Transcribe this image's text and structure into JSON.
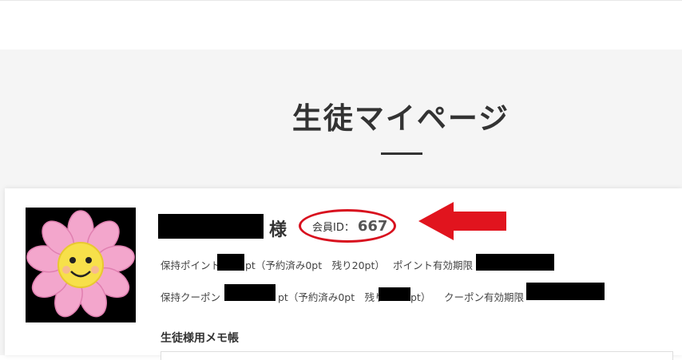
{
  "page": {
    "title": "生徒マイページ"
  },
  "profile": {
    "honorific": "様",
    "member_id_label": "会員ID：",
    "member_id_value": "667"
  },
  "points": {
    "label": "保持ポイント",
    "unit_suffix": "pt（予約済み0pt　残り20pt）",
    "expiry_label": "ポイント有効期限"
  },
  "coupons": {
    "label": "保持クーポン",
    "middle": "pt（予約済み0pt　残り",
    "tail": "pt）",
    "expiry_label": "クーポン有効期限"
  },
  "memo": {
    "heading": "生徒様用メモ帳"
  },
  "colors": {
    "accent_red": "#d8101e",
    "hero_bg": "#f5f5f5",
    "petal_pink": "#f0a0c8",
    "flower_center": "#f7e04a"
  },
  "icons": {
    "avatar": "flower-smiley-icon",
    "annotation": "red-arrow-icon"
  }
}
